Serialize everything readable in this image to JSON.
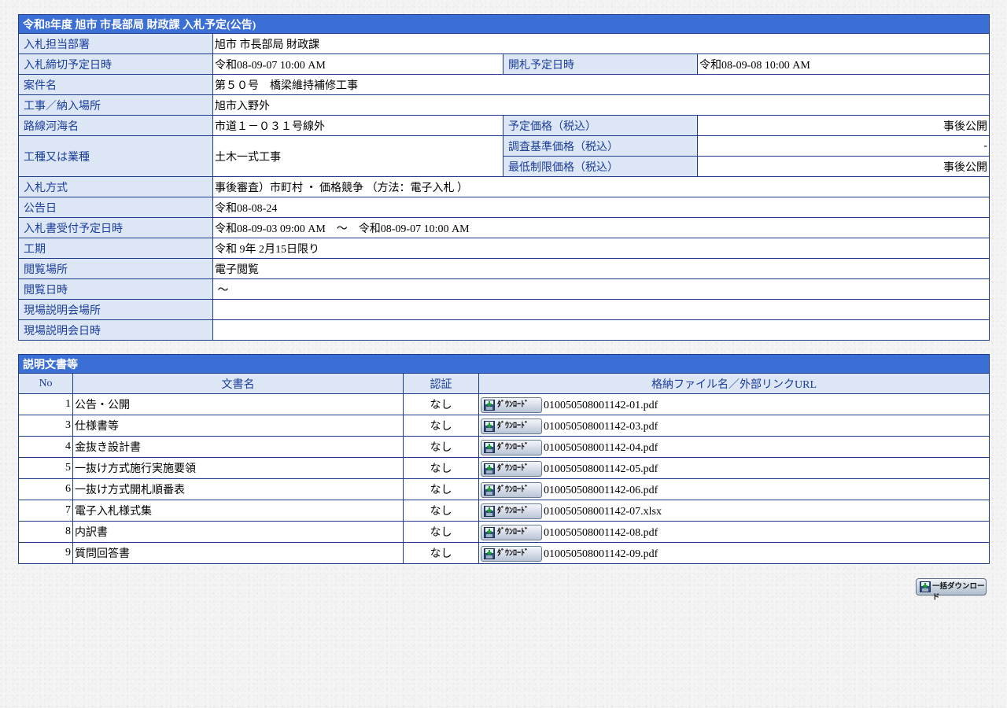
{
  "notice": {
    "title": "令和8年度 旭市 市長部局 財政課 入札予定(公告)",
    "dept_label": "入札担当部署",
    "dept_value": "旭市 市長部局 財政課",
    "deadline_label": "入札締切予定日時",
    "deadline_value": "令和08-09-07 10:00 AM",
    "opening_label": "開札予定日時",
    "opening_value": "令和08-09-08 10:00 AM",
    "case_label": "案件名",
    "case_value": "第５０号　橋梁維持補修工事",
    "place_label": "工事／納入場所",
    "place_value": "旭市入野外",
    "route_label": "路線河海名",
    "route_value": "市道１－０３１号線外",
    "planned_price_label": "予定価格（税込）",
    "planned_price_value": "事後公開",
    "work_type_label": "工種又は業種",
    "work_type_value": "土木一式工事",
    "survey_price_label": "調査基準価格（税込）",
    "survey_price_value": "-",
    "min_price_label": "最低制限価格（税込）",
    "min_price_value": "事後公開",
    "method_label": "入札方式",
    "method_value": "事後審査）市町村 ・ 価格競争 （方法：電子入札 ）",
    "announce_label": "公告日",
    "announce_value": "令和08-08-24",
    "accept_label": "入札書受付予定日時",
    "accept_value": "令和08-09-03 09:00 AM　～　令和08-09-07 10:00 AM",
    "period_label": "工期",
    "period_value": "令和 9年 2月15日限り",
    "view_place_label": "閲覧場所",
    "view_place_value": "電子閲覧",
    "view_date_label": "閲覧日時",
    "view_date_value": " ～",
    "briefing_place_label": "現場説明会場所",
    "briefing_place_value": "",
    "briefing_date_label": "現場説明会日時",
    "briefing_date_value": ""
  },
  "docs": {
    "title": "説明文書等",
    "headers": {
      "no": "No",
      "name": "文書名",
      "auth": "認証",
      "file": "格納ファイル名／外部リンクURL"
    },
    "download_label": "ﾀﾞｳﾝﾛｰﾄﾞ",
    "rows": [
      {
        "no": "1",
        "name": "公告・公開",
        "auth": "なし",
        "file": "010050508001142-01.pdf"
      },
      {
        "no": "3",
        "name": "仕様書等",
        "auth": "なし",
        "file": "010050508001142-03.pdf"
      },
      {
        "no": "4",
        "name": "金抜き設計書",
        "auth": "なし",
        "file": "010050508001142-04.pdf"
      },
      {
        "no": "5",
        "name": "一抜け方式施行実施要領",
        "auth": "なし",
        "file": "010050508001142-05.pdf"
      },
      {
        "no": "6",
        "name": "一抜け方式開札順番表",
        "auth": "なし",
        "file": "010050508001142-06.pdf"
      },
      {
        "no": "7",
        "name": "電子入札様式集",
        "auth": "なし",
        "file": "010050508001142-07.xlsx"
      },
      {
        "no": "8",
        "name": "内訳書",
        "auth": "なし",
        "file": "010050508001142-08.pdf"
      },
      {
        "no": "9",
        "name": "質問回答書",
        "auth": "なし",
        "file": "010050508001142-09.pdf"
      }
    ]
  },
  "bulk_download": {
    "label": "一括ダウンロード"
  },
  "colors": {
    "header_bg": "#3c6fd6",
    "label_bg": "#dce6f5",
    "label_text": "#1a3d9c",
    "border": "#1f3c88"
  },
  "icons": {
    "download": "download-icon"
  }
}
